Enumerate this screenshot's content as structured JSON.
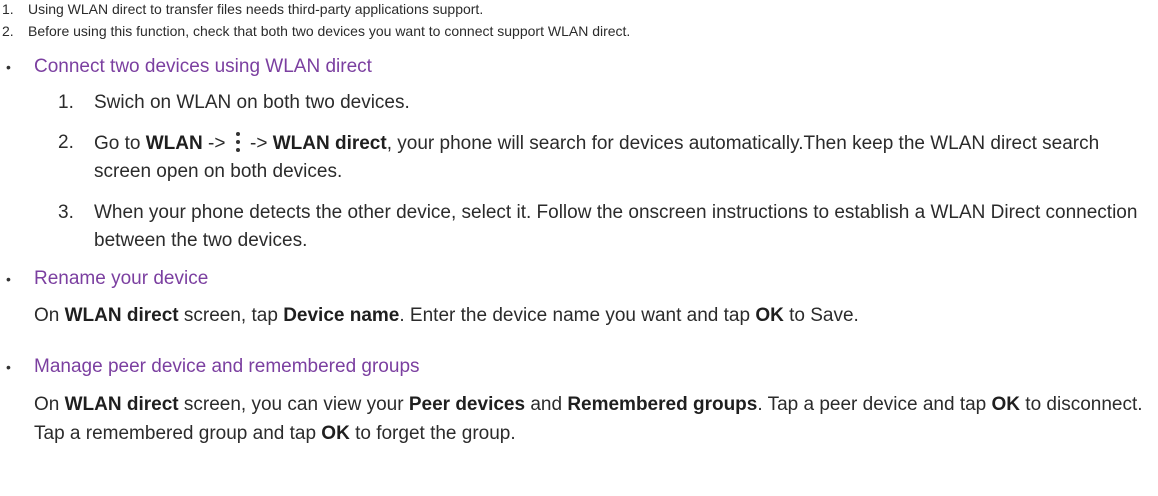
{
  "notes": [
    {
      "num": "1.",
      "text": "Using WLAN direct to transfer files needs third-party applications support."
    },
    {
      "num": "2.",
      "text": "Before using this function, check that both two devices you want to connect support WLAN direct."
    }
  ],
  "bullet_char": "•",
  "section_connect": {
    "title": "Connect two devices using WLAN direct",
    "steps": [
      {
        "num": "1.",
        "text": "Swich on WLAN on both two devices."
      },
      {
        "num": "2.",
        "pre": "Go to ",
        "b1": "WLAN",
        "arrow1": " -> ",
        "arrow2": " -> ",
        "b2": "WLAN direct",
        "post": ", your phone will search for devices automatically.Then keep the WLAN direct search screen open on both devices.",
        "icon": "more-vertical-icon"
      },
      {
        "num": "3.",
        "text": "When your phone detects the other device, select it. Follow the onscreen instructions to establish a WLAN Direct connection between the two devices."
      }
    ]
  },
  "section_rename": {
    "title": "Rename your device",
    "p_on": "On ",
    "p_b1": "WLAN direct",
    "p_mid1": " screen, tap ",
    "p_b2": "Device name",
    "p_mid2": ". Enter the device name you want and tap ",
    "p_b3": "OK",
    "p_end": " to Save."
  },
  "section_manage": {
    "title": "Manage peer device and remembered groups",
    "p_on": "On ",
    "p_b1": "WLAN direct",
    "p_mid1": " screen, you can view your ",
    "p_b2": "Peer devices",
    "p_mid2": " and ",
    "p_b3": "Remembered groups",
    "p_mid3": ". Tap a peer device and tap ",
    "p_b4": "OK",
    "p_mid4": " to disconnect. Tap a remembered group and tap ",
    "p_b5": "OK",
    "p_end": " to forget the group."
  },
  "colors": {
    "section_title": "#7b3fa0",
    "body_text": "#2b2b2b"
  }
}
